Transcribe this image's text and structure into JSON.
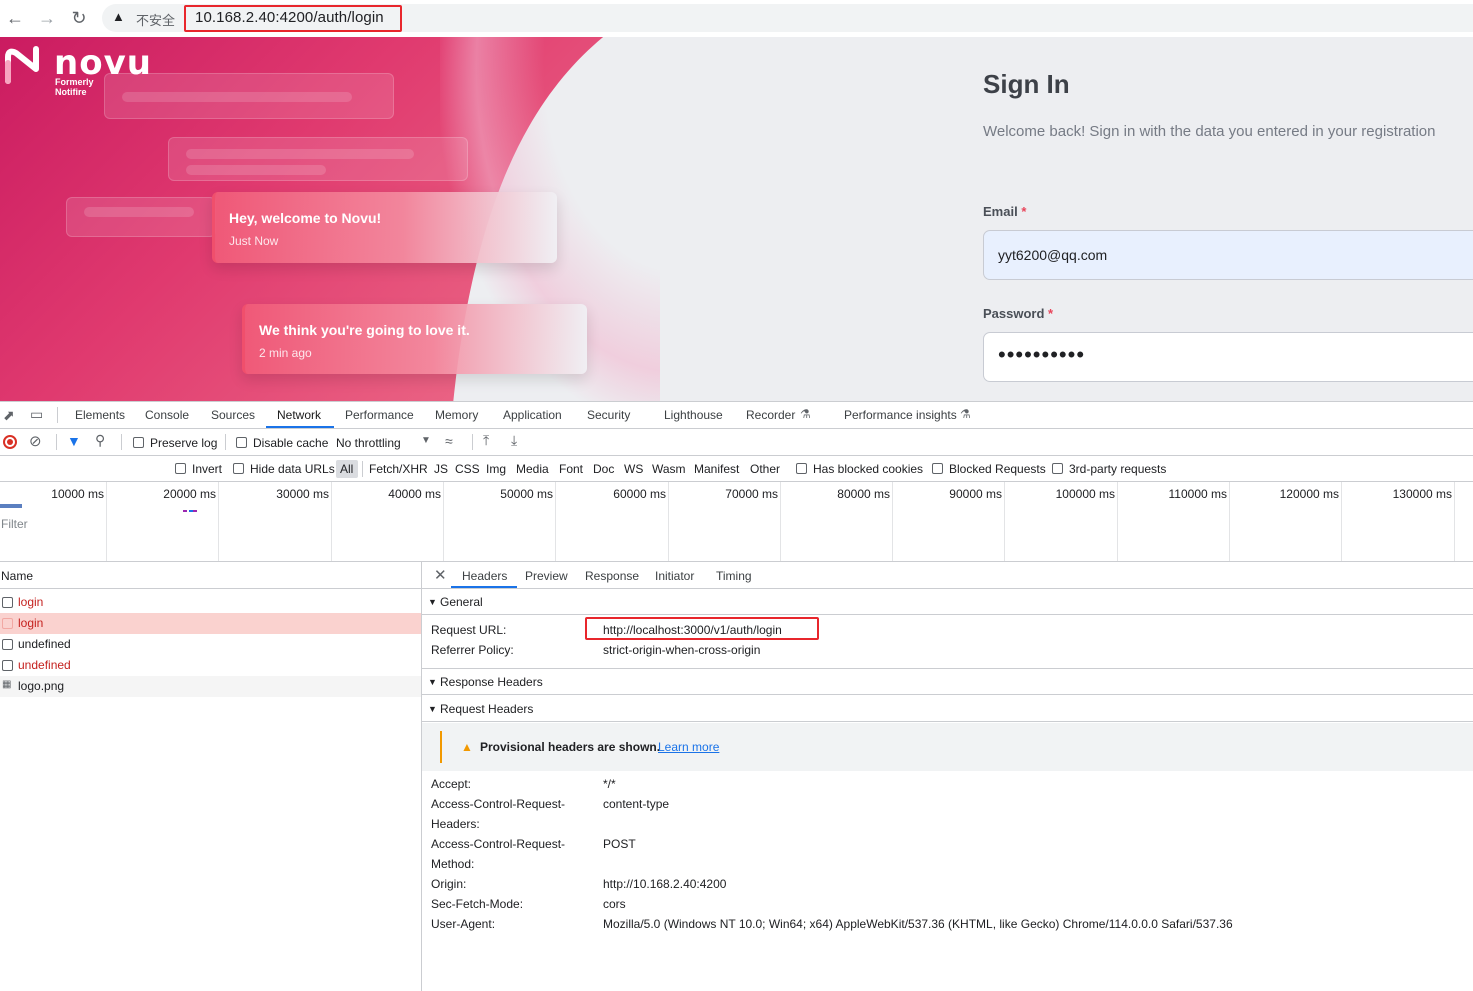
{
  "browser": {
    "insecure_label": "不安全",
    "url": "10.168.2.40:4200/auth/login"
  },
  "page": {
    "logo_text": "novu",
    "logo_subtitle": "Formerly Notifire",
    "toasts": [
      {
        "title": "Hey, welcome to Novu!",
        "time": "Just Now"
      },
      {
        "title": "We think you're going to love it.",
        "time": "2 min ago"
      }
    ],
    "signin_title": "Sign In",
    "signin_subtitle": "Welcome back! Sign in with the data you entered in your registration",
    "email_label": "Email",
    "email_value": "yyt6200@qq.com",
    "password_label": "Password",
    "password_value": "••••••••••",
    "required_mark": "*"
  },
  "devtools": {
    "tabs": [
      "Elements",
      "Console",
      "Sources",
      "Network",
      "Performance",
      "Memory",
      "Application",
      "Security",
      "Lighthouse",
      "Recorder",
      "Performance insights"
    ],
    "active_tab": "Network",
    "toolbar": {
      "preserve_log": "Preserve log",
      "disable_cache": "Disable cache",
      "throttling": "No throttling"
    },
    "filterbar": {
      "filter_placeholder": "Filter",
      "invert": "Invert",
      "hide_data_urls": "Hide data URLs",
      "types": [
        "All",
        "Fetch/XHR",
        "JS",
        "CSS",
        "Img",
        "Media",
        "Font",
        "Doc",
        "WS",
        "Wasm",
        "Manifest",
        "Other"
      ],
      "has_blocked_cookies": "Has blocked cookies",
      "blocked_requests": "Blocked Requests",
      "third_party": "3rd-party requests"
    },
    "timeline_ticks": [
      "10000 ms",
      "20000 ms",
      "30000 ms",
      "40000 ms",
      "50000 ms",
      "60000 ms",
      "70000 ms",
      "80000 ms",
      "90000 ms",
      "100000 ms",
      "110000 ms",
      "120000 ms",
      "130000 ms"
    ],
    "name_header": "Name",
    "requests": [
      {
        "name": "login",
        "color": "#c5221f"
      },
      {
        "name": "login",
        "color": "#c5221f"
      },
      {
        "name": "undefined",
        "color": "#202124"
      },
      {
        "name": "undefined",
        "color": "#c5221f"
      },
      {
        "name": "logo.png",
        "color": "#202124"
      }
    ],
    "detail_tabs": [
      "Headers",
      "Preview",
      "Response",
      "Initiator",
      "Timing"
    ],
    "general": {
      "title": "General",
      "request_url_key": "Request URL:",
      "request_url": "http://localhost:3000/v1/auth/login",
      "referrer_key": "Referrer Policy:",
      "referrer": "strict-origin-when-cross-origin"
    },
    "response_headers_title": "Response Headers",
    "request_headers_title": "Request Headers",
    "provisional_text": "Provisional headers are shown.",
    "learn_more": "Learn more",
    "request_headers": [
      {
        "key": "Accept:",
        "value": "*/*"
      },
      {
        "key": "Access-Control-Request-",
        "key2": "Headers:",
        "value": "content-type"
      },
      {
        "key": "Access-Control-Request-",
        "key2": "Method:",
        "value": "POST"
      },
      {
        "key": "Origin:",
        "value": "http://10.168.2.40:4200"
      },
      {
        "key": "Sec-Fetch-Mode:",
        "value": "cors"
      },
      {
        "key": "User-Agent:",
        "value": "Mozilla/5.0 (Windows NT 10.0; Win64; x64) AppleWebKit/537.36 (KHTML, like Gecko) Chrome/114.0.0.0 Safari/537.36"
      }
    ]
  }
}
